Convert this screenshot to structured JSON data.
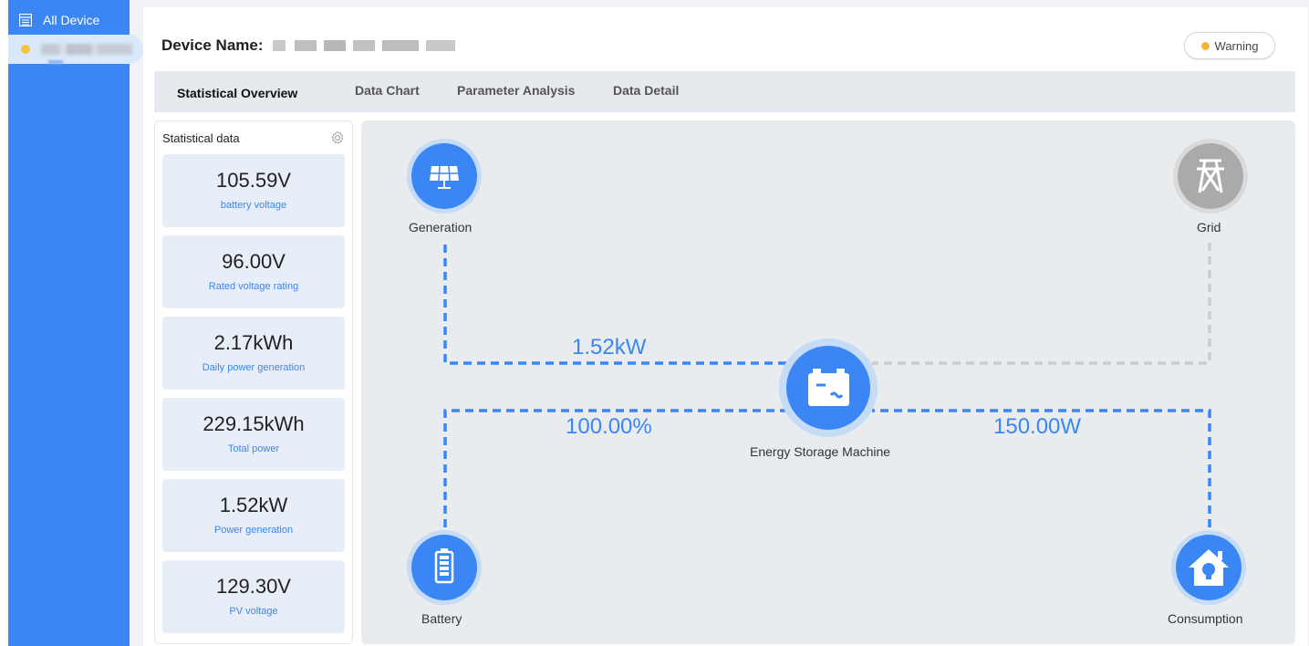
{
  "sidebar": {
    "title": "All Device",
    "device_status_color": "#f5c342"
  },
  "header": {
    "device_name_label": "Device Name:",
    "status_text": "Warning",
    "status_color": "#f5b342"
  },
  "tabs": [
    {
      "label": "Statistical Overview",
      "active": true
    },
    {
      "label": "Data Chart",
      "active": false
    },
    {
      "label": "Parameter Analysis",
      "active": false
    },
    {
      "label": "Data Detail",
      "active": false
    }
  ],
  "stats": {
    "title": "Statistical data",
    "items": [
      {
        "value": "105.59V",
        "label": "battery voltage"
      },
      {
        "value": "96.00V",
        "label": "Rated voltage rating"
      },
      {
        "value": "2.17kWh",
        "label": "Daily power generation"
      },
      {
        "value": "229.15kWh",
        "label": "Total power"
      },
      {
        "value": "1.52kW",
        "label": "Power generation"
      },
      {
        "value": "129.30V",
        "label": "PV voltage"
      }
    ]
  },
  "flow": {
    "generation": {
      "label": "Generation",
      "icon": "solar-panel-icon"
    },
    "grid": {
      "label": "Grid",
      "icon": "power-tower-icon"
    },
    "center": {
      "label": "Energy Storage Machine",
      "icon": "battery-inverter-icon"
    },
    "battery": {
      "label": "Battery",
      "icon": "battery-icon"
    },
    "consumption": {
      "label": "Consumption",
      "icon": "house-bulb-icon"
    },
    "generation_power": "1.52kW",
    "battery_soc": "100.00%",
    "consumption_power": "150.00W",
    "active_color": "#3a86f5",
    "inactive_color": "#cccccc"
  }
}
